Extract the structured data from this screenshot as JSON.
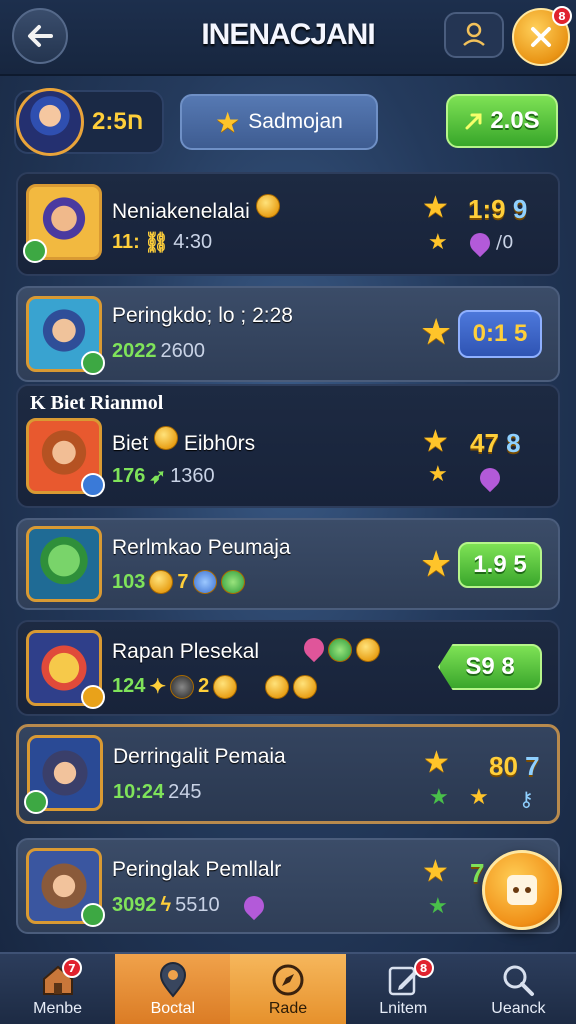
{
  "header": {
    "title": "INENACJANI",
    "close_badge": "8"
  },
  "summary": {
    "player_score": "2:5ח",
    "center_button_label": "Sadmojan",
    "green_button_label": "2.0S"
  },
  "players": [
    {
      "name": "Neniakenelalai",
      "stat_a": "11:",
      "stat_b": "4:30",
      "score": "1:9",
      "score_extra": "9",
      "extra": "/0"
    },
    {
      "name": "Peringkdo; lo ; 2:28",
      "stat_a": "2022",
      "stat_b": "2600",
      "pill": "0:1 5"
    },
    {
      "section_label": "K  Biet Rianmol",
      "name": "Biet",
      "name_suffix": "Eibh0rs",
      "stat_a": "176",
      "stat_b": "1360",
      "score": "47",
      "score_extra": "8"
    },
    {
      "name": "Rerlmkao Peumaja",
      "stat_a": "103",
      "stat_b": "7",
      "pill": "1.9 5"
    },
    {
      "name": "Rapan Plesekal",
      "stat_a": "124",
      "stat_b": "2",
      "pill": "S9 8"
    },
    {
      "name": "Derringalit Pemaia",
      "stat_a": "10:24",
      "stat_b": "245",
      "score": "80",
      "score_extra": "7"
    },
    {
      "name": "Peringlak Pemllalr",
      "stat_a": "3092",
      "stat_b": "5510",
      "score": "7"
    }
  ],
  "bottom_nav": [
    {
      "label": "Menbe",
      "badge": "7"
    },
    {
      "label": "Boctal"
    },
    {
      "label": "Rade"
    },
    {
      "label": "Lnitem",
      "badge": "8"
    },
    {
      "label": "Ueanck"
    }
  ],
  "colors": {
    "accent_orange": "#e99415",
    "accent_green": "#38a62a",
    "score_yellow": "#ffcf3a",
    "pill_blue": "#3c62c8"
  }
}
